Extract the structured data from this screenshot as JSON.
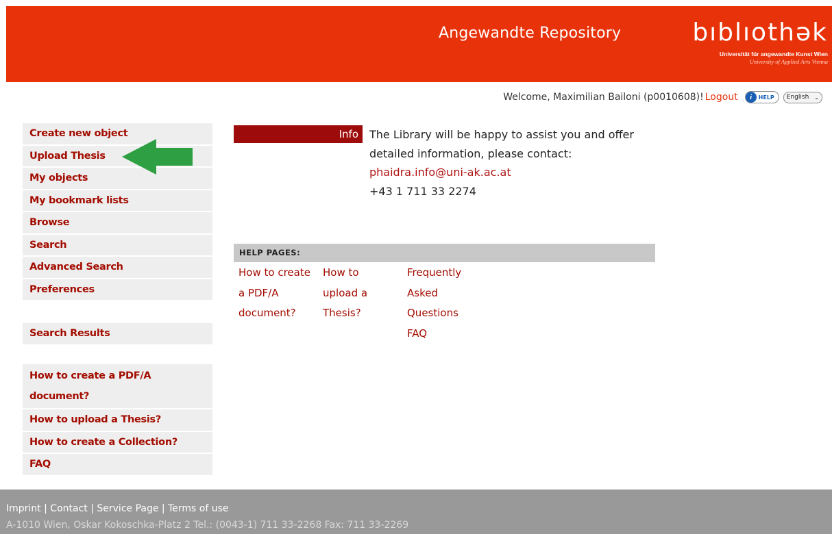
{
  "header": {
    "repository_title": "Angewandte Repository",
    "logo_word": "bıblıothək",
    "logo_sub1": "Universität für angewandte Kunst Wien",
    "logo_sub2": "University of Applied Arts Vienna",
    "bg_color": "#e8320a"
  },
  "userbar": {
    "welcome": "Welcome, Maximilian Bailoni (p0010608)!",
    "logout": "Logout",
    "help": "HELP",
    "help_icon": "info-icon",
    "language": "English"
  },
  "sidebar": {
    "main": [
      "Create new object",
      "Upload Thesis",
      "My objects",
      "My bookmark lists",
      "Browse",
      "Search",
      "Advanced Search",
      "Preferences"
    ],
    "results": [
      "Search Results"
    ],
    "help": [
      "How to create a PDF/A document?",
      "How to upload a Thesis?",
      "How to create a Collection?",
      "FAQ"
    ]
  },
  "info": {
    "tag": "Info",
    "line1": "The Library will be happy to assist you and offer",
    "line2": "detailed information, please contact:",
    "email": "phaidra.info@uni-ak.ac.at",
    "phone": "+43 1 711 33 2274"
  },
  "help_pages": {
    "heading": "HELP PAGES:",
    "links": [
      [
        "How to create",
        "a PDF/A",
        "document?"
      ],
      [
        "How to",
        "upload a",
        "Thesis?"
      ],
      [
        "Frequently",
        "Asked",
        "Questions",
        "FAQ"
      ]
    ]
  },
  "footer": {
    "imprint": "Imprint",
    "contact": "Contact",
    "service": "Service Page",
    "terms": "Terms of use",
    "address": "A-1010 Wien, Oskar Kokoschka-Platz 2 Tel.: (0043-1) 711 33-2268 Fax: 711 33-2269"
  },
  "annotation": {
    "arrow_color": "#2ea043"
  }
}
